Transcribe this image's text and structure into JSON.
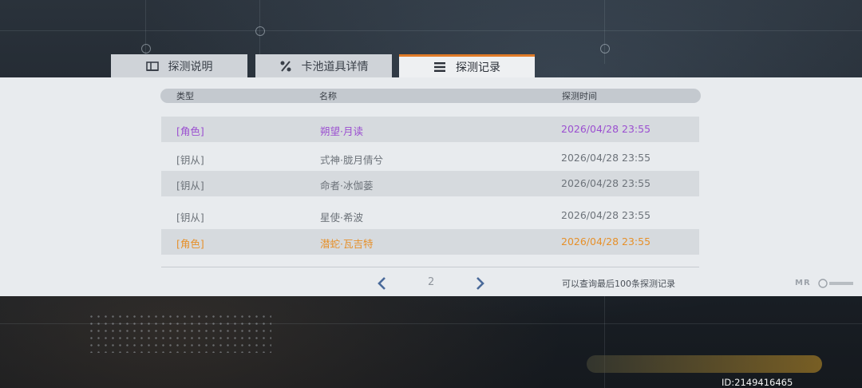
{
  "tabs": [
    {
      "label": "探测说明",
      "icon": "info-book-icon"
    },
    {
      "label": "卡池道具详情",
      "icon": "percent-icon"
    },
    {
      "label": "探测记录",
      "icon": "list-menu-icon",
      "active": true
    }
  ],
  "table": {
    "headers": {
      "type": "类型",
      "name": "名称",
      "time": "探测时间"
    },
    "rows": [
      {
        "type": "[角色]",
        "name": "朔望·月读",
        "time": "2026/04/28 23:55",
        "color": "#9b4fd0"
      },
      {
        "type": "[钥从]",
        "name": "式神·胧月倩兮",
        "time": "2026/04/28 23:55",
        "color": "#6d737a"
      },
      {
        "type": "[钥从]",
        "name": "命者·冰伽蒌",
        "time": "2026/04/28 23:55",
        "color": "#6d737a"
      },
      {
        "type": "[钥从]",
        "name": "星使·希波",
        "time": "2026/04/28 23:55",
        "color": "#6d737a"
      },
      {
        "type": "[角色]",
        "name": "潜蛇·瓦吉特",
        "time": "2026/04/28 23:55",
        "color": "#e6902a"
      }
    ]
  },
  "pagination": {
    "current_page": "2",
    "note": "可以查询最后100条探测记录"
  },
  "branding": {
    "logo_text": "MR"
  },
  "footer": {
    "id_label": "ID:2149416465"
  },
  "colors": {
    "accent": "#e07b28",
    "rare_purple": "#9b4fd0",
    "common_gray": "#6d737a",
    "legendary_orange": "#e6902a"
  }
}
